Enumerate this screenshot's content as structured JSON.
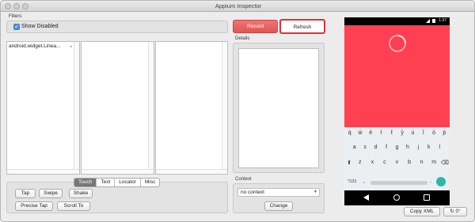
{
  "window": {
    "title": "Appium Inspector"
  },
  "filters": {
    "label": "Filters",
    "show_disabled": "Show Disabled"
  },
  "toolbar": {
    "record": "Record",
    "refresh": "Refresh"
  },
  "tree": {
    "first_item": "android.widget.Linea...",
    "indicator": "►"
  },
  "details": {
    "label": "Details"
  },
  "tabs": {
    "touch": "Touch",
    "text": "Text",
    "locator": "Locator",
    "misc": "Misc"
  },
  "actions": {
    "tap": "Tap",
    "swipe": "Swipe",
    "shake": "Shake",
    "precise_tap": "Precise Tap",
    "scroll_to": "Scroll To"
  },
  "context": {
    "label": "Context",
    "selected": "no context",
    "change": "Change"
  },
  "device": {
    "clock": "1:37",
    "number_hints": [
      "1",
      "2",
      "3",
      "4",
      "5",
      "6",
      "7",
      "8",
      "9",
      "0"
    ],
    "row1": [
      "q",
      "w",
      "e",
      "r",
      "t",
      "y",
      "u",
      "i",
      "o",
      "p"
    ],
    "row2": [
      "a",
      "s",
      "d",
      "f",
      "g",
      "h",
      "j",
      "k",
      "l"
    ],
    "row3": [
      "z",
      "x",
      "c",
      "v",
      "b",
      "n",
      "m"
    ],
    "symbols_key": "?123",
    "comma_key": ",",
    "period_key": ".",
    "accent_color": "#ff4052"
  },
  "footer": {
    "copy_xml": "Copy XML",
    "rotation": "0°"
  }
}
